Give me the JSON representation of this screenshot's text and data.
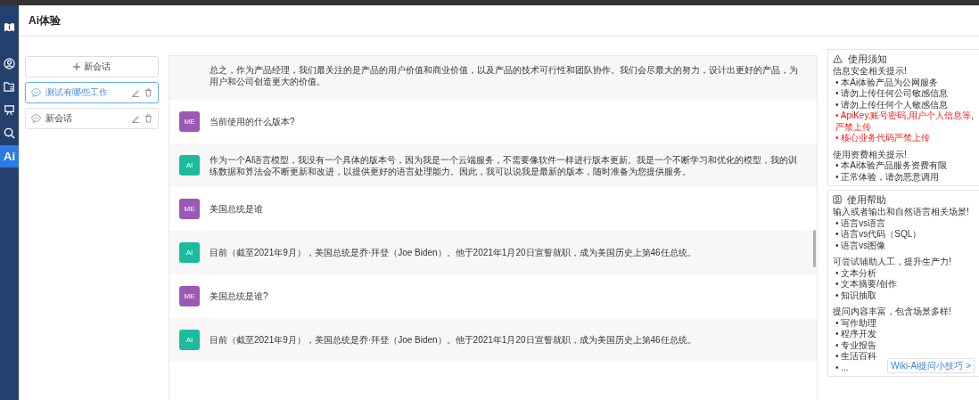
{
  "nav": {
    "items": [
      {
        "kind": "logo",
        "selected": false
      },
      {
        "kind": "user",
        "selected": false
      },
      {
        "kind": "folder",
        "selected": false
      },
      {
        "kind": "board",
        "selected": false
      },
      {
        "kind": "search",
        "selected": false
      },
      {
        "kind": "text",
        "label": "Ai",
        "selected": true
      }
    ]
  },
  "header": {
    "title": "Ai体验"
  },
  "sessions": {
    "new_button": "新会话",
    "items": [
      {
        "title": "测试有哪些工作",
        "selected": true
      },
      {
        "title": "新会话",
        "selected": false
      }
    ]
  },
  "chat": {
    "messages": [
      {
        "kind": "ai",
        "text": "总之，作为产品经理，我们最关注的是产品的用户价值和商业价值，以及产品的技术可行性和团队协作。我们会尽最大的努力，设计出更好的产品，为用户和公司创造更大的价值。"
      },
      {
        "kind": "me",
        "avatar": "ME",
        "text": "当前使用的什么版本?"
      },
      {
        "kind": "ai",
        "avatar": "AI",
        "text": "作为一个AI语言模型，我没有一个具体的版本号，因为我是一个云端服务，不需要像软件一样进行版本更新。我是一个不断学习和优化的模型，我的训练数据和算法会不断更新和改进，以提供更好的语言处理能力。因此，我可以说我是最新的版本，随时准备为您提供服务。"
      },
      {
        "kind": "me",
        "avatar": "ME",
        "text": "美国总统是谁"
      },
      {
        "kind": "ai",
        "avatar": "AI",
        "text": "目前（截至2021年9月），美国总统是乔·拜登（Joe Biden）。他于2021年1月20日宣誓就职，成为美国历史上第46任总统。"
      },
      {
        "kind": "me",
        "avatar": "ME",
        "text": "美国总统是谁?"
      },
      {
        "kind": "ai",
        "avatar": "AI",
        "text": "目前（截至2021年9月），美国总统是乔·拜登（Joe Biden）。他于2021年1月20日宣誓就职，成为美国历史上第46任总统。"
      }
    ]
  },
  "panels": [
    {
      "kind": "notice",
      "title": "使用须知",
      "groups": [
        {
          "heading": "信息安全相关提示!",
          "items": [
            {
              "text": "• 本Ai体验产品为公网服务",
              "warning": false
            },
            {
              "text": "• 请勿上传任何公司敏感信息",
              "warning": false
            },
            {
              "text": "• 请勿上传任何个人敏感信息",
              "warning": false
            },
            {
              "text": "• ApiKey,账号密码,用户个人信息等,严禁上传",
              "warning": true
            },
            {
              "text": "• 核心业务代码严禁上传",
              "warning": true
            }
          ]
        },
        {
          "heading": "使用资费相关提示!",
          "items": [
            {
              "text": "• 本Ai体验产品服务资费有限",
              "warning": false
            },
            {
              "text": "• 正常体验，请勿恶意调用",
              "warning": false
            }
          ]
        }
      ]
    },
    {
      "kind": "help",
      "title": "使用帮助",
      "link": "Wiki-Ai提问小技巧 >",
      "groups": [
        {
          "heading": "输入或者输出和自然语言相关场景!",
          "items": [
            {
              "text": "• 语言vs语言",
              "warning": false
            },
            {
              "text": "• 语言vs代码（SQL）",
              "warning": false
            },
            {
              "text": "• 语言vs图像",
              "warning": false
            }
          ]
        },
        {
          "heading": "可尝试辅助人工，提升生产力!",
          "items": [
            {
              "text": "• 文本分析",
              "warning": false
            },
            {
              "text": "• 文本摘要/创作",
              "warning": false
            },
            {
              "text": "• 知识抽取",
              "warning": false
            }
          ]
        },
        {
          "heading": "提问内容丰富，包含场景多样!",
          "items": [
            {
              "text": "• 写作助理",
              "warning": false
            },
            {
              "text": "• 程序开发",
              "warning": false
            },
            {
              "text": "• 专业报告",
              "warning": false
            },
            {
              "text": "• 生活百科",
              "warning": false
            },
            {
              "text": "• ...",
              "warning": false
            }
          ]
        }
      ]
    }
  ]
}
